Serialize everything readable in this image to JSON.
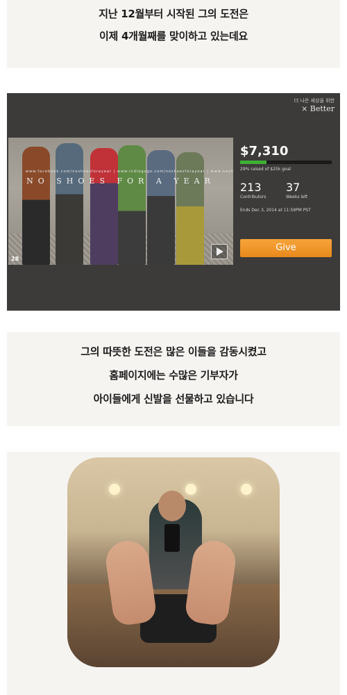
{
  "section1": {
    "line1": "지난 12월부터 시작된 그의 도전은",
    "line2": "이제 4개월째를 맞이하고 있는데요"
  },
  "campaign": {
    "brand_small": "더 나은 세상을 위한",
    "brand": "× Better",
    "photo_title": "NO SHOES FOR A YEAR",
    "photo_url": "www.facebook.com/noshoesforayear  |  www.indiegogo.com/noshoesforayear  |  www.noshoesforayear.com",
    "photo_count": "28",
    "amount": "$7,310",
    "progress_fraction": 0.29,
    "raised_text": "29% raised of $25k goal",
    "contributors_num": "213",
    "contributors_label": "Contributors",
    "weeks_num": "37",
    "weeks_label": "Weeks left",
    "ends_text": "Ends Dec 3, 2014 at 11:59PM PST",
    "give_label": "Give",
    "colors": {
      "give": "#f09a2a",
      "progress": "#3cb034",
      "panel": "#3d3b39"
    }
  },
  "section2": {
    "line1": "그의 따뜻한 도전은 많은 이들을 감동시켰고",
    "line2": "홈페이지에는 수많은 기부자가",
    "line3": "아이들에게 신발을 선물하고 있습니다"
  }
}
